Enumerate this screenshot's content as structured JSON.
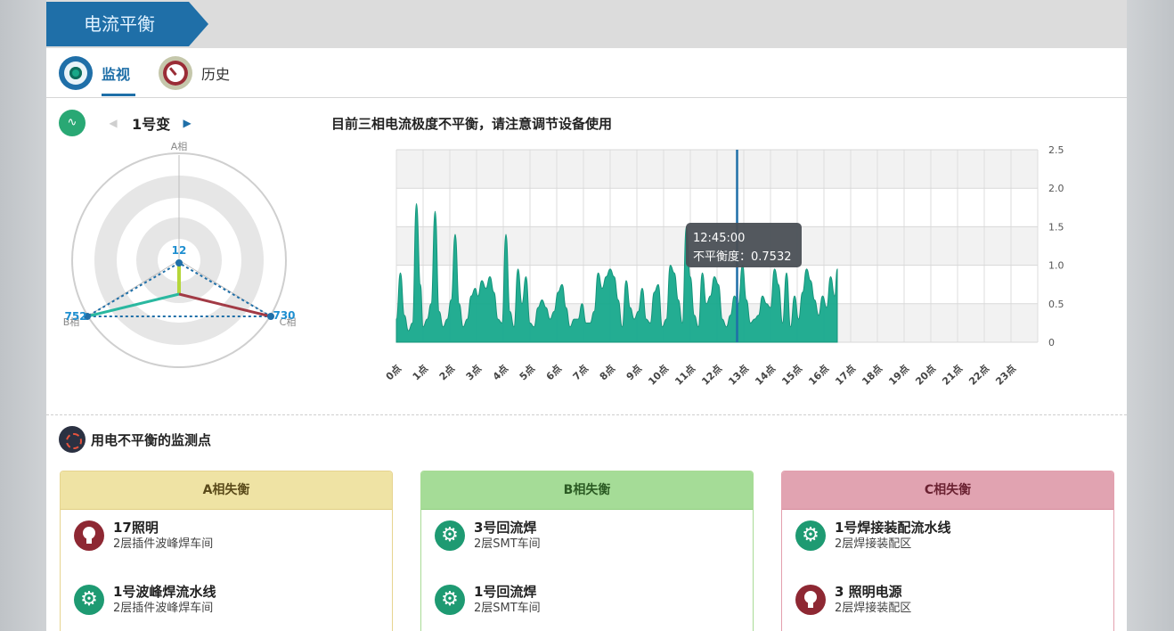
{
  "header": {
    "title": "电流平衡"
  },
  "tabs": [
    {
      "label": "监视",
      "active": true,
      "icon": "eye-icon"
    },
    {
      "label": "历史",
      "active": false,
      "icon": "clock-icon"
    }
  ],
  "selector": {
    "icon": "wave-icon",
    "prev_icon": "◀",
    "next_icon": "▶",
    "station": "1号变"
  },
  "radar": {
    "axes": [
      {
        "label": "A相",
        "value": "12"
      },
      {
        "label": "B相",
        "value": "752"
      },
      {
        "label": "C相",
        "value": "730"
      }
    ]
  },
  "chart": {
    "title": "目前三相电流极度不平衡，请注意调节设备使用",
    "tooltip": {
      "time": "12:45:00",
      "text": "不平衡度：0.7532"
    }
  },
  "chart_data": {
    "type": "area",
    "title": "目前三相电流极度不平衡，请注意调节设备使用",
    "categories": [
      "0点",
      "1点",
      "2点",
      "3点",
      "4点",
      "5点",
      "6点",
      "7点",
      "8点",
      "9点",
      "10点",
      "11点",
      "12点",
      "13点",
      "14点",
      "15点",
      "16点",
      "17点",
      "18点",
      "19点",
      "20点",
      "21点",
      "22点",
      "23点"
    ],
    "ylim": [
      0,
      2.5
    ],
    "yticks": [
      "0",
      "0.5",
      "1.0",
      "1.5",
      "2.0",
      "2.5"
    ],
    "y_axis_position": "right",
    "grid": true,
    "color": "#17a98c",
    "x": [
      0,
      0.15,
      0.3,
      0.45,
      0.6,
      0.75,
      0.9,
      1.0,
      1.15,
      1.3,
      1.45,
      1.6,
      1.75,
      1.9,
      2.05,
      2.2,
      2.35,
      2.5,
      2.65,
      2.8,
      2.95,
      3.05,
      3.2,
      3.35,
      3.5,
      3.65,
      3.8,
      3.95,
      4.1,
      4.25,
      4.4,
      4.55,
      4.7,
      4.85,
      5.0,
      5.15,
      5.3,
      5.45,
      5.6,
      5.75,
      5.9,
      6.05,
      6.2,
      6.35,
      6.5,
      6.65,
      6.8,
      6.95,
      7.1,
      7.25,
      7.4,
      7.55,
      7.7,
      7.85,
      8.0,
      8.15,
      8.3,
      8.45,
      8.6,
      8.75,
      8.9,
      9.05,
      9.2,
      9.35,
      9.5,
      9.65,
      9.8,
      9.95,
      10.1,
      10.25,
      10.4,
      10.55,
      10.7,
      10.85,
      11.0,
      11.15,
      11.3,
      11.45,
      11.6,
      11.75,
      11.9,
      12.05,
      12.2,
      12.35,
      12.5,
      12.65,
      12.8,
      12.95,
      13.1,
      13.25,
      13.4,
      13.55,
      13.7,
      13.85,
      14.0,
      14.15,
      14.3,
      14.45,
      14.6,
      14.75,
      14.9,
      15.05,
      15.2,
      15.35,
      15.5,
      15.65,
      15.8,
      15.95,
      16.1,
      16.25,
      16.4,
      16.5
    ],
    "values": [
      0.3,
      0.9,
      0.35,
      0.15,
      0.25,
      1.8,
      0.75,
      0.2,
      0.3,
      0.5,
      1.7,
      0.4,
      0.2,
      0.3,
      0.55,
      1.4,
      0.5,
      0.2,
      0.3,
      0.6,
      0.7,
      0.6,
      0.8,
      0.7,
      0.85,
      0.65,
      0.3,
      0.25,
      1.4,
      0.4,
      0.2,
      0.95,
      0.5,
      0.85,
      0.25,
      0.2,
      0.45,
      0.55,
      0.45,
      0.3,
      0.4,
      0.65,
      0.75,
      0.45,
      0.2,
      0.3,
      0.3,
      0.5,
      0.25,
      0.25,
      0.4,
      0.9,
      0.7,
      0.85,
      0.95,
      0.85,
      0.55,
      0.2,
      0.8,
      0.45,
      0.3,
      0.4,
      0.7,
      0.3,
      0.25,
      0.65,
      0.75,
      0.2,
      0.3,
      1.0,
      0.9,
      0.55,
      0.25,
      1.5,
      0.85,
      0.35,
      0.2,
      0.9,
      0.5,
      0.6,
      0.85,
      0.75,
      0.3,
      0.2,
      0.35,
      0.6,
      0.5,
      1.0,
      0.55,
      0.25,
      0.3,
      0.35,
      0.6,
      0.5,
      0.45,
      0.95,
      0.75,
      0.25,
      0.9,
      0.2,
      0.6,
      0.3,
      0.65,
      0.95,
      0.8,
      0.55,
      0.35,
      0.6,
      0.45,
      0.85,
      0.6,
      0.95
    ],
    "marker_time": 12.75,
    "marker_value": 0.7532
  },
  "section": {
    "title": "用电不平衡的监测点",
    "icon": "target-icon"
  },
  "groups": [
    {
      "header": "A相失衡",
      "items": [
        {
          "name": "17照明",
          "location": "2层插件波峰焊车间",
          "icon": "bulb-icon"
        },
        {
          "name": "1号波峰焊流水线",
          "location": "2层插件波峰焊车间",
          "icon": "gear-icon"
        }
      ]
    },
    {
      "header": "B相失衡",
      "items": [
        {
          "name": "3号回流焊",
          "location": "2层SMT车间",
          "icon": "gear-icon"
        },
        {
          "name": "1号回流焊",
          "location": "2层SMT车间",
          "icon": "gear-icon"
        }
      ]
    },
    {
      "header": "C相失衡",
      "items": [
        {
          "name": "1号焊接装配流水线",
          "location": "2层焊接装配区",
          "icon": "gear-icon"
        },
        {
          "name": "3 照明电源",
          "location": "2层焊接装配区",
          "icon": "bulb-icon"
        }
      ]
    }
  ]
}
